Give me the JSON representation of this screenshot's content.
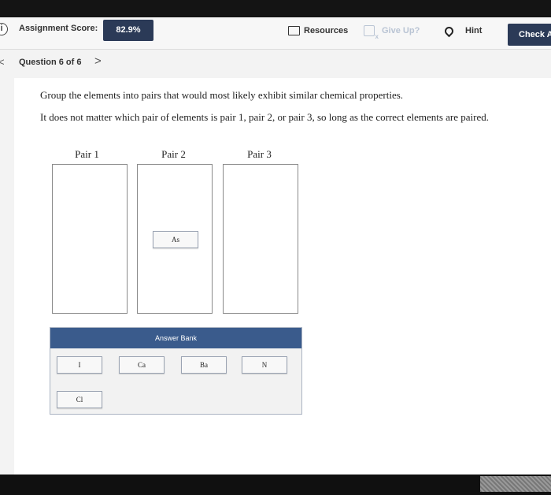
{
  "topbar": {
    "score_label": "Assignment Score:",
    "score_value": "82.9%",
    "resources_label": "Resources",
    "giveup_label": "Give Up?",
    "hint_label": "Hint",
    "check_label": "Check An"
  },
  "nav": {
    "question_label": "Question 6 of 6"
  },
  "question": {
    "line1": "Group the elements into pairs that would most likely exhibit similar chemical properties.",
    "line2": "It does not matter which pair of elements is pair 1, pair 2, or pair 3, so long as the correct elements are paired."
  },
  "pairs": [
    {
      "label": "Pair 1",
      "elements": []
    },
    {
      "label": "Pair 2",
      "elements": [
        "As"
      ]
    },
    {
      "label": "Pair 3",
      "elements": []
    }
  ],
  "answer_bank": {
    "title": "Answer Bank",
    "items": [
      "I",
      "Ca",
      "Ba",
      "N",
      "Cl"
    ]
  },
  "colors": {
    "navy": "#2b3a57",
    "bank_header": "#3a5b8c"
  }
}
